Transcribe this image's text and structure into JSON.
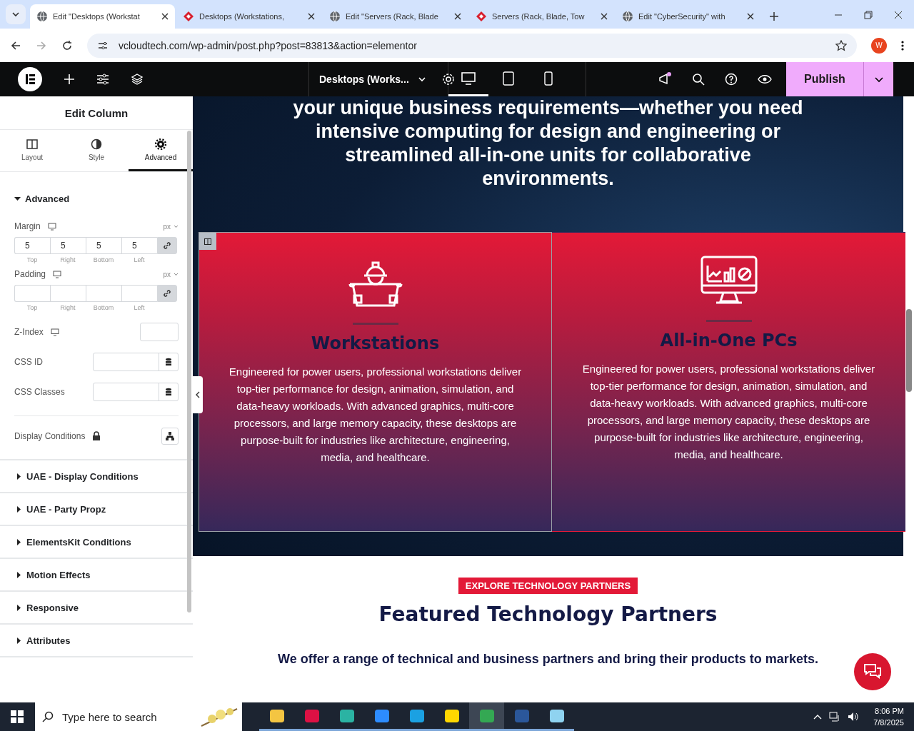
{
  "browser": {
    "tabs": [
      {
        "title": "Edit \"Desktops (Workstat",
        "kind": "globe",
        "selected": true
      },
      {
        "title": "Desktops (Workstations,",
        "kind": "logo",
        "selected": false
      },
      {
        "title": "Edit \"Servers (Rack, Blade",
        "kind": "globe",
        "selected": false
      },
      {
        "title": "Servers (Rack, Blade, Tow",
        "kind": "logo",
        "selected": false
      },
      {
        "title": "Edit \"CyberSecurity\" with",
        "kind": "globe",
        "selected": false
      }
    ],
    "url": "vcloudtech.com/wp-admin/post.php?post=83813&action=elementor",
    "profile": "W"
  },
  "editor_bar": {
    "document": "Desktops (Works...",
    "devices": [
      {
        "kind": "desktop",
        "selected": true
      },
      {
        "kind": "tablet",
        "selected": false
      },
      {
        "kind": "mobile",
        "selected": false
      }
    ],
    "publish": "Publish"
  },
  "panel": {
    "title": "Edit Column",
    "tabs": [
      {
        "label": "Layout",
        "kind": "layout",
        "selected": false
      },
      {
        "label": "Style",
        "kind": "style",
        "selected": false
      },
      {
        "label": "Advanced",
        "kind": "gear",
        "selected": true
      }
    ],
    "section": {
      "title": "Advanced",
      "expanded": true
    },
    "margin": {
      "label": "Margin",
      "unit": "px",
      "values": [
        "5",
        "5",
        "5",
        "5"
      ],
      "sides": [
        "Top",
        "Right",
        "Bottom",
        "Left"
      ],
      "linked": true
    },
    "padding": {
      "label": "Padding",
      "unit": "px",
      "sides": [
        "Top",
        "Right",
        "Bottom",
        "Left"
      ],
      "linked": true
    },
    "z_index": "Z-Index",
    "css_id": "CSS ID",
    "css_classes": "CSS Classes",
    "display_conditions": "Display Conditions",
    "sections": [
      {
        "title": "UAE - Display Conditions",
        "expanded": false
      },
      {
        "title": "UAE - Party Propz",
        "expanded": false
      },
      {
        "title": "ElementsKit Conditions",
        "expanded": false
      },
      {
        "title": "Motion Effects",
        "expanded": false
      },
      {
        "title": "Responsive",
        "expanded": false
      },
      {
        "title": "Attributes",
        "expanded": false
      }
    ]
  },
  "canvas": {
    "intro": [
      "your unique business requirements—whether you need",
      "intensive computing for design and engineering or",
      "streamlined all-in-one units for collaborative",
      "environments."
    ],
    "cards": [
      {
        "kind": "engineer",
        "title": "Workstations",
        "text": "Engineered for power users, professional workstations deliver top-tier performance for design, animation, simulation, and data-heavy workloads. With advanced graphics, multi-core processors, and large memory capacity, these desktops are purpose-built for industries like architecture, engineering, media, and healthcare.",
        "selected": true
      },
      {
        "kind": "monitor",
        "title": "All-in-One PCs",
        "text": "Engineered for power users, professional workstations deliver top-tier performance for design, animation, simulation, and data-heavy workloads. With advanced graphics, multi-core processors, and large memory capacity, these desktops are purpose-built for industries like architecture, engineering, media, and healthcare.",
        "selected": false
      }
    ],
    "badge": "EXPLORE TECHNOLOGY PARTNERS",
    "heading": "Featured Technology Partners",
    "text": "We offer a range of technical and business partners and bring their products to markets."
  },
  "taskbar": {
    "placeholder": "Type here to search",
    "apps": [
      {
        "kind": "folder",
        "active": false
      },
      {
        "kind": "snip",
        "active": false
      },
      {
        "kind": "gem",
        "active": false
      },
      {
        "kind": "zoom",
        "active": false
      },
      {
        "kind": "edge",
        "active": false
      },
      {
        "kind": "notes",
        "active": false
      },
      {
        "kind": "chrome",
        "active": true
      },
      {
        "kind": "word",
        "active": false
      },
      {
        "kind": "notepad",
        "active": false
      }
    ],
    "time": "8:06 PM",
    "date": "7/8/2025"
  }
}
